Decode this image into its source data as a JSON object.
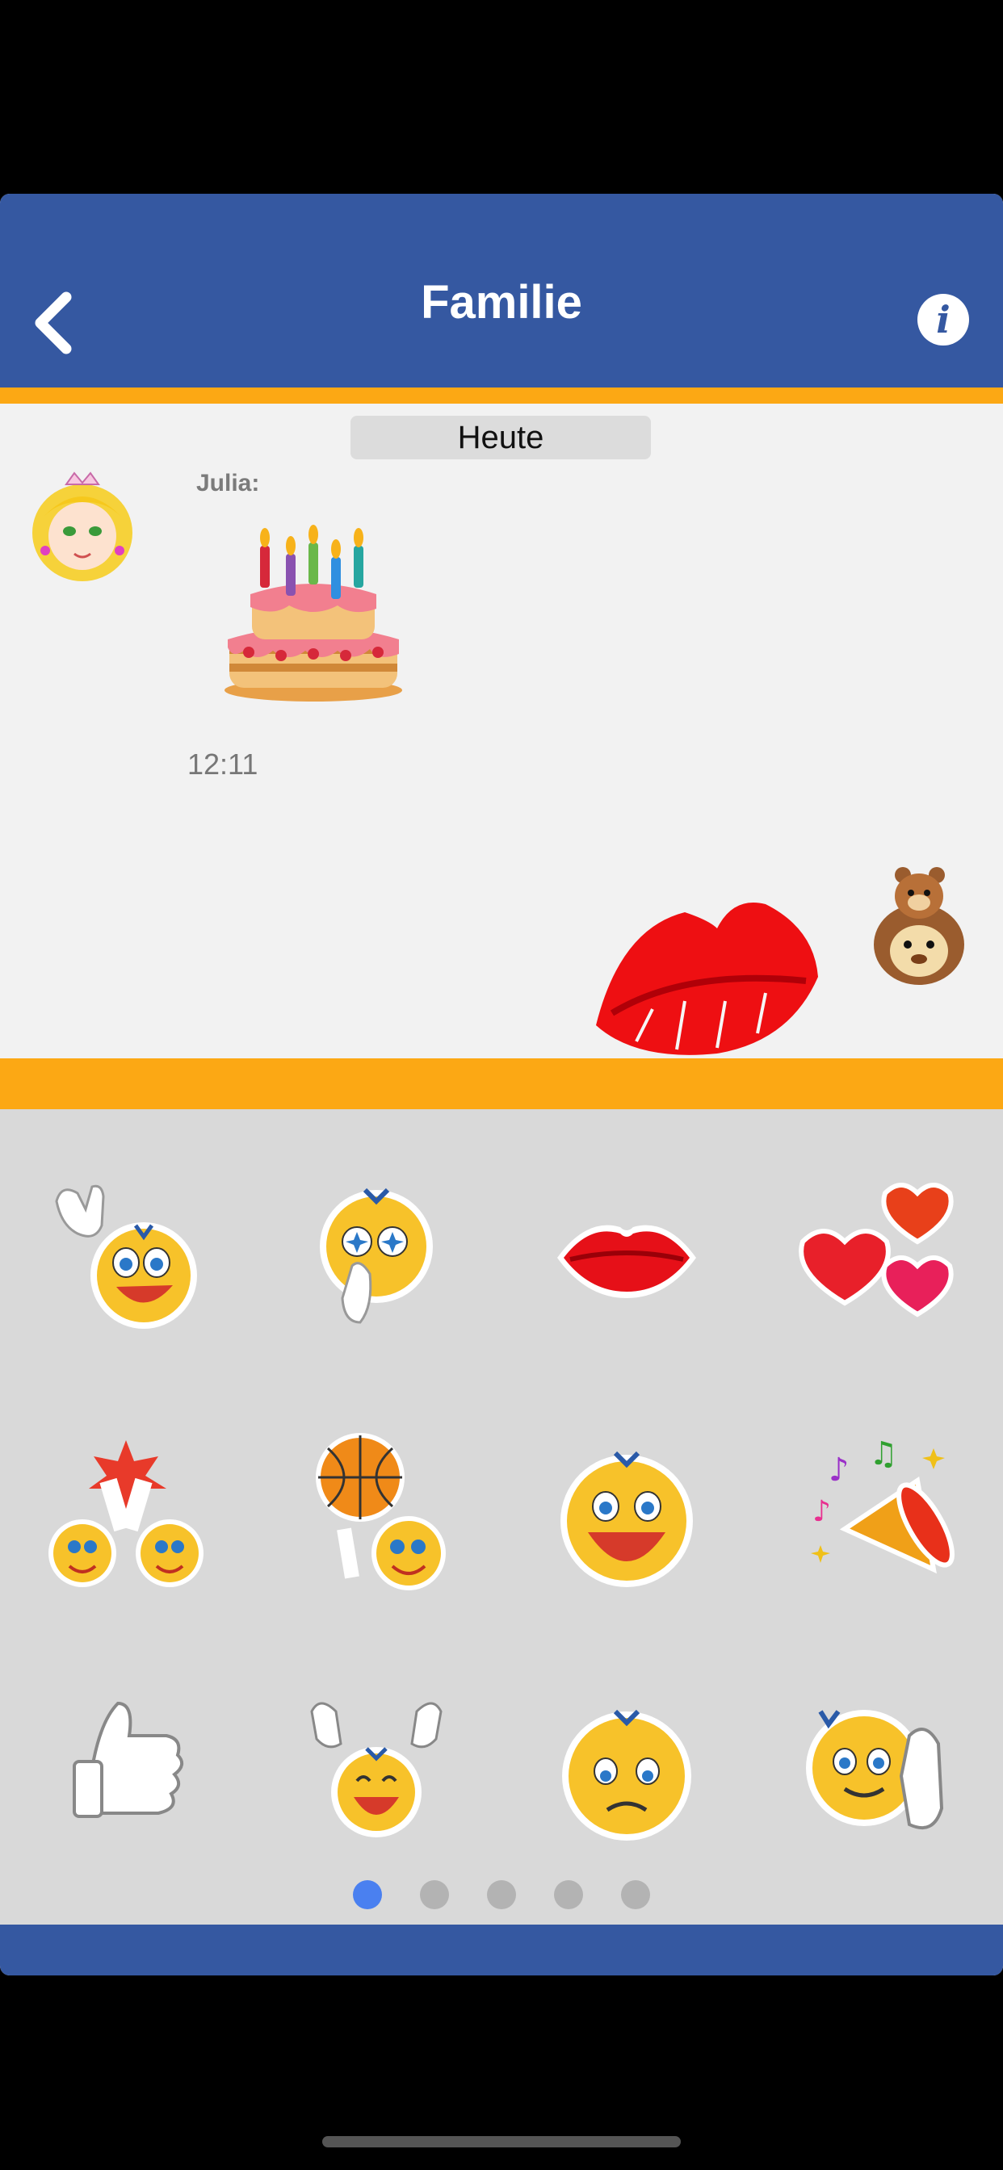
{
  "header": {
    "title": "Familie",
    "back_icon": "chevron-left-icon",
    "info_label": "i"
  },
  "chat": {
    "date_separator": "Heute",
    "messages": [
      {
        "sender": "Julia:",
        "sticker": "birthday-cake",
        "time": "12:11"
      },
      {
        "sender": "",
        "sticker": "kiss-lips",
        "time": ""
      }
    ]
  },
  "stickers": [
    {
      "name": "waving-smiley"
    },
    {
      "name": "starry-eyed-smiley"
    },
    {
      "name": "kiss-lips"
    },
    {
      "name": "hearts"
    },
    {
      "name": "high-five-smileys"
    },
    {
      "name": "basketball-smiley"
    },
    {
      "name": "laughing-smiley"
    },
    {
      "name": "party-horn"
    },
    {
      "name": "thumbs-up"
    },
    {
      "name": "cheering-smiley"
    },
    {
      "name": "sad-smiley"
    },
    {
      "name": "greeting-smiley"
    }
  ],
  "pager": {
    "pages": 5,
    "current": 1
  },
  "colors": {
    "header_blue": "#3558a1",
    "accent_orange": "#fca814",
    "chat_bg": "#f2f2f2",
    "panel_bg": "#d9d9d9",
    "active_dot": "#4a80f0"
  }
}
